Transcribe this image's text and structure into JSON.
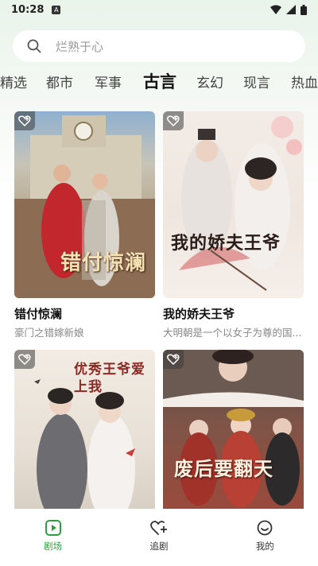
{
  "status": {
    "time": "10:28",
    "sim_label": "A"
  },
  "search": {
    "placeholder": "烂熟于心"
  },
  "tabs": [
    {
      "label": "精选"
    },
    {
      "label": "都市"
    },
    {
      "label": "军事"
    },
    {
      "label": "古言",
      "active": true
    },
    {
      "label": "玄幻"
    },
    {
      "label": "现言"
    },
    {
      "label": "热血"
    }
  ],
  "cards": [
    {
      "title": "错付惊澜",
      "desc": "豪门之错嫁新娘",
      "poster_text": "错付惊澜",
      "icon": "favorite-add-icon"
    },
    {
      "title": "我的娇夫王爷",
      "desc": "大明朝是一个以女子为尊的国...",
      "poster_text": "我的娇夫王爷",
      "icon": "favorite-add-icon"
    },
    {
      "title": "",
      "desc": "",
      "poster_text": "优秀王爷爱上我",
      "icon": "favorite-add-icon"
    },
    {
      "title": "",
      "desc": "",
      "poster_text": "废后要翻天",
      "icon": "favorite-add-icon"
    }
  ],
  "bottom_nav": [
    {
      "label": "剧场",
      "icon": "theater-icon",
      "active": true
    },
    {
      "label": "追剧",
      "icon": "follow-heart-icon"
    },
    {
      "label": "我的",
      "icon": "profile-icon"
    }
  ],
  "colors": {
    "accent": "#2ea043",
    "background_top": "#e9f4ea"
  }
}
